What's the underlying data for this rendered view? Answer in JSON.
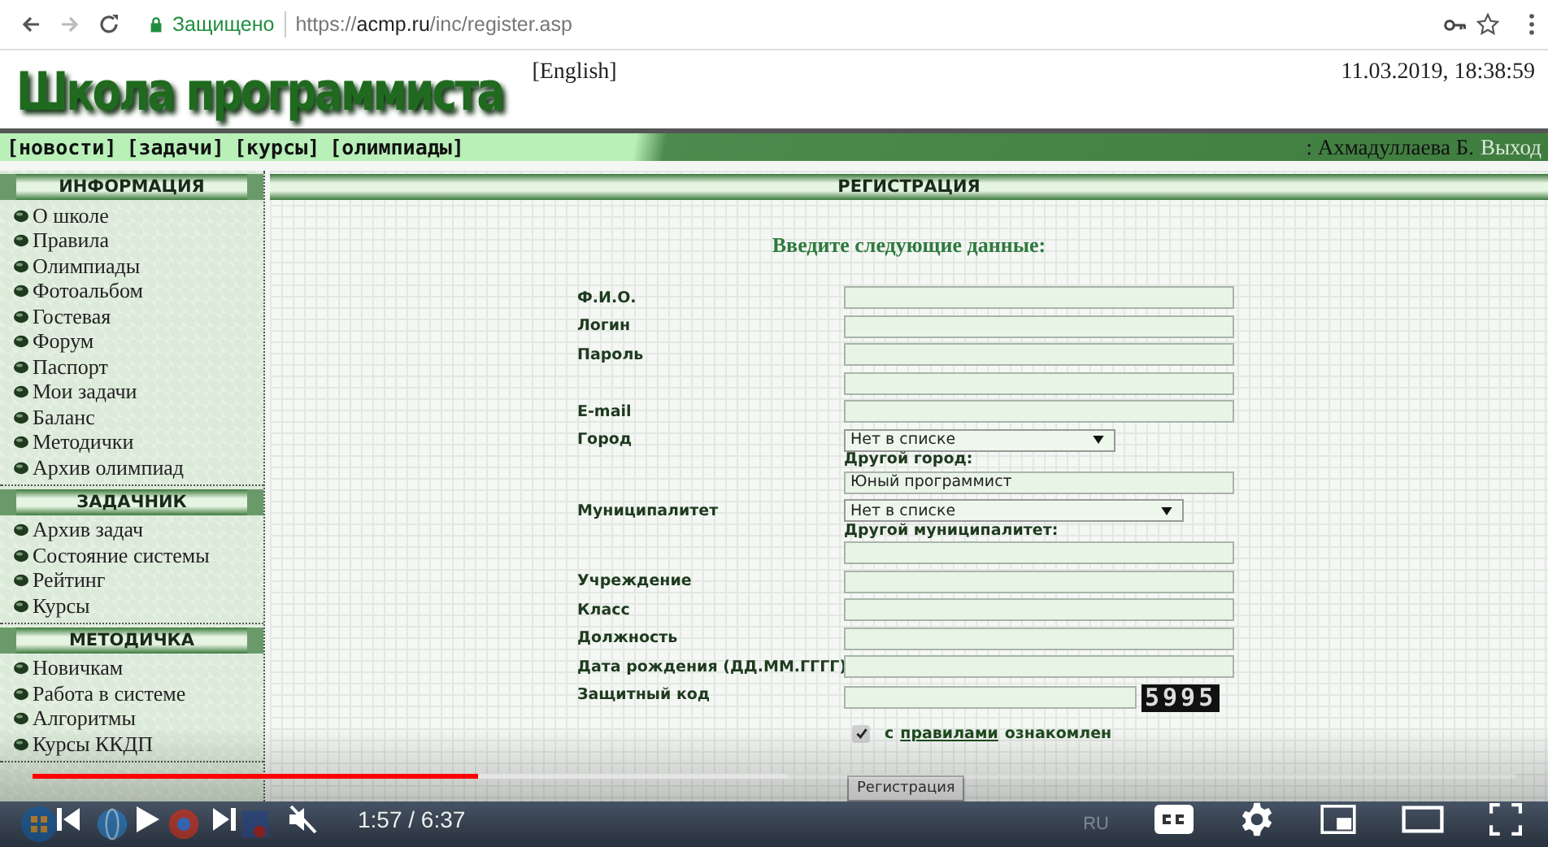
{
  "browser": {
    "secure_label": "Защищено",
    "url_scheme": "https://",
    "url_host": "acmp.ru",
    "url_path": "/inc/register.asp"
  },
  "header": {
    "logo": "Школа программиста",
    "language_link": "[English]",
    "datetime": "11.03.2019, 18:38:59"
  },
  "nav": {
    "links": [
      "[новости]",
      "[задачи]",
      "[курсы]",
      "[олимпиады]"
    ],
    "user": ": Ахмадуллаева Б.",
    "logout": "Выход"
  },
  "sidebar": [
    {
      "title": "ИНФОРМАЦИЯ",
      "items": [
        "О школе",
        "Правила",
        "Олимпиады",
        "Фотоальбом",
        "Гостевая",
        "Форум",
        "Паспорт",
        "Мои задачи",
        "Баланс",
        "Методички",
        "Архив олимпиад"
      ]
    },
    {
      "title": "ЗАДАЧНИК",
      "items": [
        "Архив задач",
        "Состояние системы",
        "Рейтинг",
        "Курсы"
      ]
    },
    {
      "title": "МЕТОДИЧКА",
      "items": [
        "Новичкам",
        "Работа в системе",
        "Алгоритмы",
        "Курсы ККДП"
      ]
    }
  ],
  "main": {
    "title": "РЕГИСТРАЦИЯ",
    "heading": "Введите следующие данные:",
    "rows": [
      {
        "kind": "field",
        "label": "Ф.И.О."
      },
      {
        "kind": "field",
        "label": "Логин"
      },
      {
        "kind": "field",
        "label": "Пароль"
      },
      {
        "kind": "field"
      },
      {
        "kind": "field",
        "label": "E-mail"
      },
      {
        "kind": "select",
        "label": "Город",
        "value": "Нет в списке",
        "wide": false
      },
      {
        "kind": "caption",
        "text": "Другой город:"
      },
      {
        "kind": "field",
        "value": "Юный программист"
      },
      {
        "kind": "select",
        "label": "Муниципалитет",
        "value": "Нет в списке",
        "wide": true
      },
      {
        "kind": "caption",
        "text": "Другой муниципалитет:"
      },
      {
        "kind": "field"
      },
      {
        "kind": "field",
        "label": "Учреждение"
      },
      {
        "kind": "field",
        "label": "Класс"
      },
      {
        "kind": "field",
        "label": "Должность"
      },
      {
        "kind": "field",
        "label": "Дата рождения (ДД.ММ.ГГГГ)"
      },
      {
        "kind": "captcha",
        "label": "Защитный код",
        "code": "5995"
      }
    ],
    "agree": {
      "checked": true,
      "before": "с",
      "link": "правилами",
      "after": "ознакомлен"
    },
    "submit": "Регистрация"
  },
  "taskbar": {
    "language": "RU"
  },
  "player": {
    "progress": {
      "level": 0.3
    },
    "buffer": {
      "level": 0.51
    },
    "muted": true,
    "time": "1:57 / 6:37"
  }
}
